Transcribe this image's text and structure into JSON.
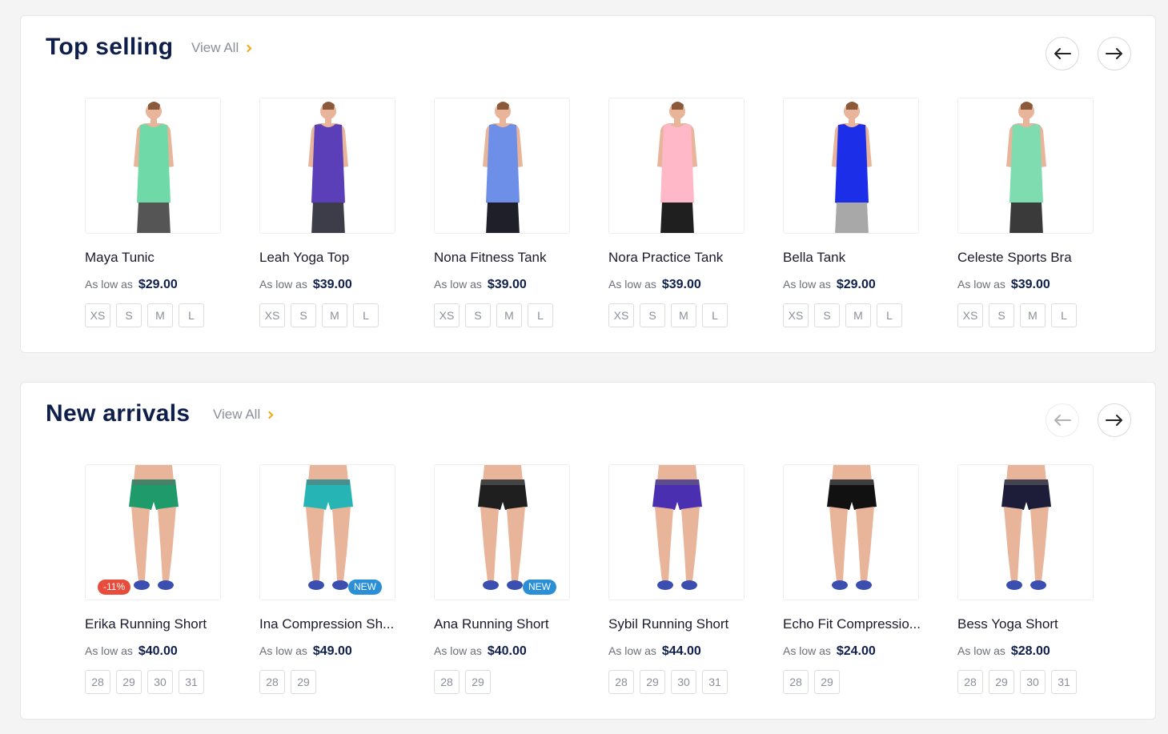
{
  "sections": [
    {
      "title": "Top selling",
      "view_all": "View All",
      "prev_enabled": true,
      "next_enabled": true,
      "products": [
        {
          "name": "Maya Tunic",
          "price_prefix": "As low as",
          "price": "$29.00",
          "sizes": [
            "XS",
            "S",
            "M",
            "L"
          ],
          "badge": "",
          "top_color": "#6fdaa8",
          "bottom_color": "#555555"
        },
        {
          "name": "Leah Yoga Top",
          "price_prefix": "As low as",
          "price": "$39.00",
          "sizes": [
            "XS",
            "S",
            "M",
            "L"
          ],
          "badge": "",
          "top_color": "#5a3fb8",
          "bottom_color": "#3d3d4a"
        },
        {
          "name": "Nona Fitness Tank",
          "price_prefix": "As low as",
          "price": "$39.00",
          "sizes": [
            "XS",
            "S",
            "M",
            "L"
          ],
          "badge": "",
          "top_color": "#6d8fe8",
          "bottom_color": "#1f1f2a"
        },
        {
          "name": "Nora Practice Tank",
          "price_prefix": "As low as",
          "price": "$39.00",
          "sizes": [
            "XS",
            "S",
            "M",
            "L"
          ],
          "badge": "",
          "top_color": "#ffb8c8",
          "bottom_color": "#1f1f1f"
        },
        {
          "name": "Bella Tank",
          "price_prefix": "As low as",
          "price": "$29.00",
          "sizes": [
            "XS",
            "S",
            "M",
            "L"
          ],
          "badge": "",
          "top_color": "#1c2ee8",
          "bottom_color": "#a8a8a8"
        },
        {
          "name": "Celeste Sports Bra",
          "price_prefix": "As low as",
          "price": "$39.00",
          "sizes": [
            "XS",
            "S",
            "M",
            "L"
          ],
          "badge": "",
          "top_color": "#7fdcb0",
          "bottom_color": "#3a3a3a"
        }
      ]
    },
    {
      "title": "New arrivals",
      "view_all": "View All",
      "prev_enabled": false,
      "next_enabled": true,
      "products": [
        {
          "name": "Erika Running Short",
          "price_prefix": "As low as",
          "price": "$40.00",
          "sizes": [
            "28",
            "29",
            "30",
            "31"
          ],
          "badge": "-11%",
          "badge_type": "sale",
          "top_color": "#1f9a6b",
          "bottom_color": "#e8b49a"
        },
        {
          "name": "Ina Compression Sh...",
          "price_prefix": "As low as",
          "price": "$49.00",
          "sizes": [
            "28",
            "29"
          ],
          "badge": "NEW",
          "badge_type": "new",
          "top_color": "#27b4b4",
          "bottom_color": "#e8b49a"
        },
        {
          "name": "Ana Running Short",
          "price_prefix": "As low as",
          "price": "$40.00",
          "sizes": [
            "28",
            "29"
          ],
          "badge": "NEW",
          "badge_type": "new",
          "top_color": "#1f1f1f",
          "bottom_color": "#e8b49a"
        },
        {
          "name": "Sybil Running Short",
          "price_prefix": "As low as",
          "price": "$44.00",
          "sizes": [
            "28",
            "29",
            "30",
            "31"
          ],
          "badge": "",
          "top_color": "#4a2fb0",
          "bottom_color": "#e8b49a"
        },
        {
          "name": "Echo Fit Compressio...",
          "price_prefix": "As low as",
          "price": "$24.00",
          "sizes": [
            "28",
            "29"
          ],
          "badge": "",
          "top_color": "#111111",
          "bottom_color": "#e8b49a"
        },
        {
          "name": "Bess Yoga Short",
          "price_prefix": "As low as",
          "price": "$28.00",
          "sizes": [
            "28",
            "29",
            "30",
            "31"
          ],
          "badge": "",
          "top_color": "#1d1d3a",
          "bottom_color": "#e8b49a"
        }
      ]
    }
  ]
}
